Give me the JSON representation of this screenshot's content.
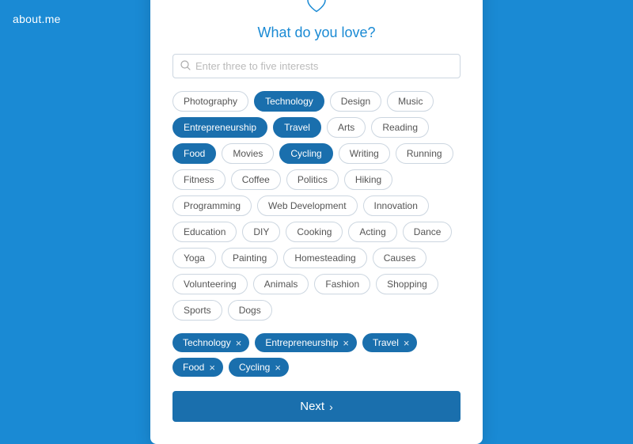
{
  "app": {
    "logo": "about.me"
  },
  "progress": {
    "segments": [
      {
        "filled": true
      },
      {
        "filled": false
      },
      {
        "filled": false
      }
    ]
  },
  "page": {
    "title": "What do you love?",
    "search_placeholder": "Enter three to five interests"
  },
  "tags": [
    {
      "label": "Photography",
      "selected": false
    },
    {
      "label": "Technology",
      "selected": true
    },
    {
      "label": "Design",
      "selected": false
    },
    {
      "label": "Music",
      "selected": false
    },
    {
      "label": "Entrepreneurship",
      "selected": true
    },
    {
      "label": "Travel",
      "selected": true
    },
    {
      "label": "Arts",
      "selected": false
    },
    {
      "label": "Reading",
      "selected": false
    },
    {
      "label": "Food",
      "selected": true
    },
    {
      "label": "Movies",
      "selected": false
    },
    {
      "label": "Cycling",
      "selected": true
    },
    {
      "label": "Writing",
      "selected": false
    },
    {
      "label": "Running",
      "selected": false
    },
    {
      "label": "Fitness",
      "selected": false
    },
    {
      "label": "Coffee",
      "selected": false
    },
    {
      "label": "Politics",
      "selected": false
    },
    {
      "label": "Hiking",
      "selected": false
    },
    {
      "label": "Programming",
      "selected": false
    },
    {
      "label": "Web Development",
      "selected": false
    },
    {
      "label": "Innovation",
      "selected": false
    },
    {
      "label": "Education",
      "selected": false
    },
    {
      "label": "DIY",
      "selected": false
    },
    {
      "label": "Cooking",
      "selected": false
    },
    {
      "label": "Acting",
      "selected": false
    },
    {
      "label": "Dance",
      "selected": false
    },
    {
      "label": "Yoga",
      "selected": false
    },
    {
      "label": "Painting",
      "selected": false
    },
    {
      "label": "Homesteading",
      "selected": false
    },
    {
      "label": "Causes",
      "selected": false
    },
    {
      "label": "Volunteering",
      "selected": false
    },
    {
      "label": "Animals",
      "selected": false
    },
    {
      "label": "Fashion",
      "selected": false
    },
    {
      "label": "Shopping",
      "selected": false
    },
    {
      "label": "Sports",
      "selected": false
    },
    {
      "label": "Dogs",
      "selected": false
    }
  ],
  "selected_chips": [
    {
      "label": "Technology"
    },
    {
      "label": "Entrepreneurship"
    },
    {
      "label": "Travel"
    },
    {
      "label": "Food"
    },
    {
      "label": "Cycling"
    }
  ],
  "buttons": {
    "next_label": "Next"
  }
}
